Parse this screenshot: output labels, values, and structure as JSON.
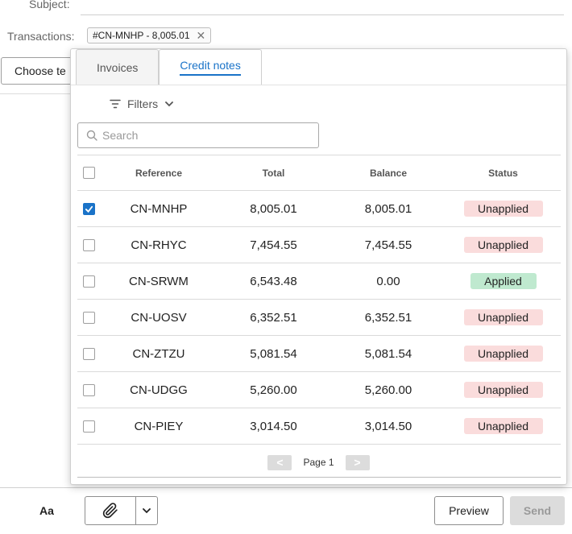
{
  "form": {
    "subject_label": "Subject:",
    "transactions_label": "Transactions:",
    "chip_text": "#CN-MNHP - 8,005.01",
    "choose_button_label": "Choose te"
  },
  "panel": {
    "tabs": [
      {
        "label": "Invoices",
        "active": false
      },
      {
        "label": "Credit notes",
        "active": true
      }
    ],
    "filters_label": "Filters",
    "search_placeholder": "Search",
    "columns": {
      "reference": "Reference",
      "total": "Total",
      "balance": "Balance",
      "status": "Status"
    },
    "rows": [
      {
        "reference": "CN-MNHP",
        "total": "8,005.01",
        "balance": "8,005.01",
        "status": "Unapplied",
        "checked": true
      },
      {
        "reference": "CN-RHYC",
        "total": "7,454.55",
        "balance": "7,454.55",
        "status": "Unapplied",
        "checked": false
      },
      {
        "reference": "CN-SRWM",
        "total": "6,543.48",
        "balance": "0.00",
        "status": "Applied",
        "checked": false
      },
      {
        "reference": "CN-UOSV",
        "total": "6,352.51",
        "balance": "6,352.51",
        "status": "Unapplied",
        "checked": false
      },
      {
        "reference": "CN-ZTZU",
        "total": "5,081.54",
        "balance": "5,081.54",
        "status": "Unapplied",
        "checked": false
      },
      {
        "reference": "CN-UDGG",
        "total": "5,260.00",
        "balance": "5,260.00",
        "status": "Unapplied",
        "checked": false
      },
      {
        "reference": "CN-PIEY",
        "total": "3,014.50",
        "balance": "3,014.50",
        "status": "Unapplied",
        "checked": false
      }
    ],
    "pager": {
      "prev": "<",
      "label": "Page 1",
      "next": ">"
    }
  },
  "toolbar": {
    "format_label": "Aa",
    "preview_label": "Preview",
    "send_label": "Send"
  },
  "colors": {
    "accent": "#1a73c8",
    "unapplied_bg": "#fadcdc",
    "applied_bg": "#bfe9cf"
  }
}
